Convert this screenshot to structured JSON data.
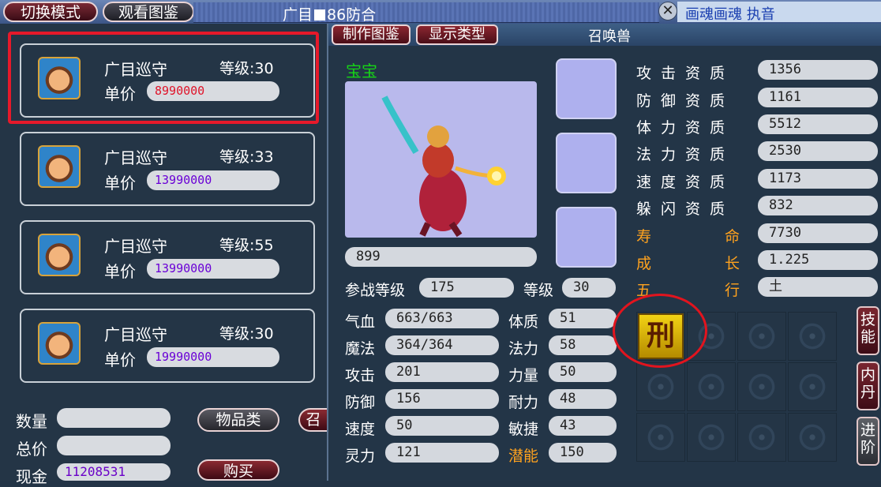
{
  "topbar": {
    "switch_mode": "切换模式",
    "view_catalog": "观看图鉴",
    "title_left": "广目",
    "title_right": "86防合",
    "close": "✕",
    "right_text": "画魂画魂  执音"
  },
  "listings": [
    {
      "name": "广目巡守",
      "level": "等级:30",
      "price_label": "单价",
      "price": "8990000",
      "price_color": "#e0142a"
    },
    {
      "name": "广目巡守",
      "level": "等级:33",
      "price_label": "单价",
      "price": "13990000",
      "price_color": "#6a00d6"
    },
    {
      "name": "广目巡守",
      "level": "等级:55",
      "price_label": "单价",
      "price": "13990000",
      "price_color": "#6a00d6"
    },
    {
      "name": "广目巡守",
      "level": "等级:30",
      "price_label": "单价",
      "price": "19990000",
      "price_color": "#6a00d6"
    }
  ],
  "purchase": {
    "qty_label": "数量",
    "total_label": "总价",
    "cash_label": "现金",
    "cash_value": "11208531",
    "items_button": "物品类",
    "summon_button": "召",
    "buy_button": "购买"
  },
  "pet": {
    "make_catalog_btn": "制作图鉴",
    "show_type_btn": "显示类型",
    "panel_title": "召唤兽",
    "baby_label": "宝宝",
    "pet_number": "899",
    "battle_level_label": "参战等级",
    "battle_level": "175",
    "level_label": "等级",
    "level": "30",
    "stats": [
      {
        "label": "气血",
        "value": "663/663"
      },
      {
        "label": "魔法",
        "value": "364/364"
      },
      {
        "label": "攻击",
        "value": "201"
      },
      {
        "label": "防御",
        "value": "156"
      },
      {
        "label": "速度",
        "value": "50"
      },
      {
        "label": "灵力",
        "value": "121"
      }
    ],
    "points": [
      {
        "label": "体质",
        "value": "51",
        "orange": false
      },
      {
        "label": "法力",
        "value": "58",
        "orange": false
      },
      {
        "label": "力量",
        "value": "50",
        "orange": false
      },
      {
        "label": "耐力",
        "value": "48",
        "orange": false
      },
      {
        "label": "敏捷",
        "value": "43",
        "orange": false
      },
      {
        "label": "潜能",
        "value": "150",
        "orange": true
      }
    ],
    "aptitudes": [
      {
        "label": "攻击资质",
        "value": "1356",
        "orange": false
      },
      {
        "label": "防御资质",
        "value": "1161",
        "orange": false
      },
      {
        "label": "体力资质",
        "value": "5512",
        "orange": false
      },
      {
        "label": "法力资质",
        "value": "2530",
        "orange": false
      },
      {
        "label": "速度资质",
        "value": "1173",
        "orange": false
      },
      {
        "label": "躲闪资质",
        "value": "832",
        "orange": false
      },
      {
        "label_a": "寿",
        "label_b": "命",
        "value": "7730",
        "orange": true
      },
      {
        "label_a": "成",
        "label_b": "长",
        "value": "1.225",
        "orange": true
      },
      {
        "label_a": "五",
        "label_b": "行",
        "value": "土",
        "orange": true
      }
    ],
    "skill_glyph": "刑",
    "tabs": [
      "技能",
      "内丹",
      "进阶"
    ]
  },
  "colors": {
    "price_red": "#e0142a",
    "price_purple": "#6a00d6",
    "baby_green": "#16d616",
    "orange_label": "#ffa21e"
  }
}
